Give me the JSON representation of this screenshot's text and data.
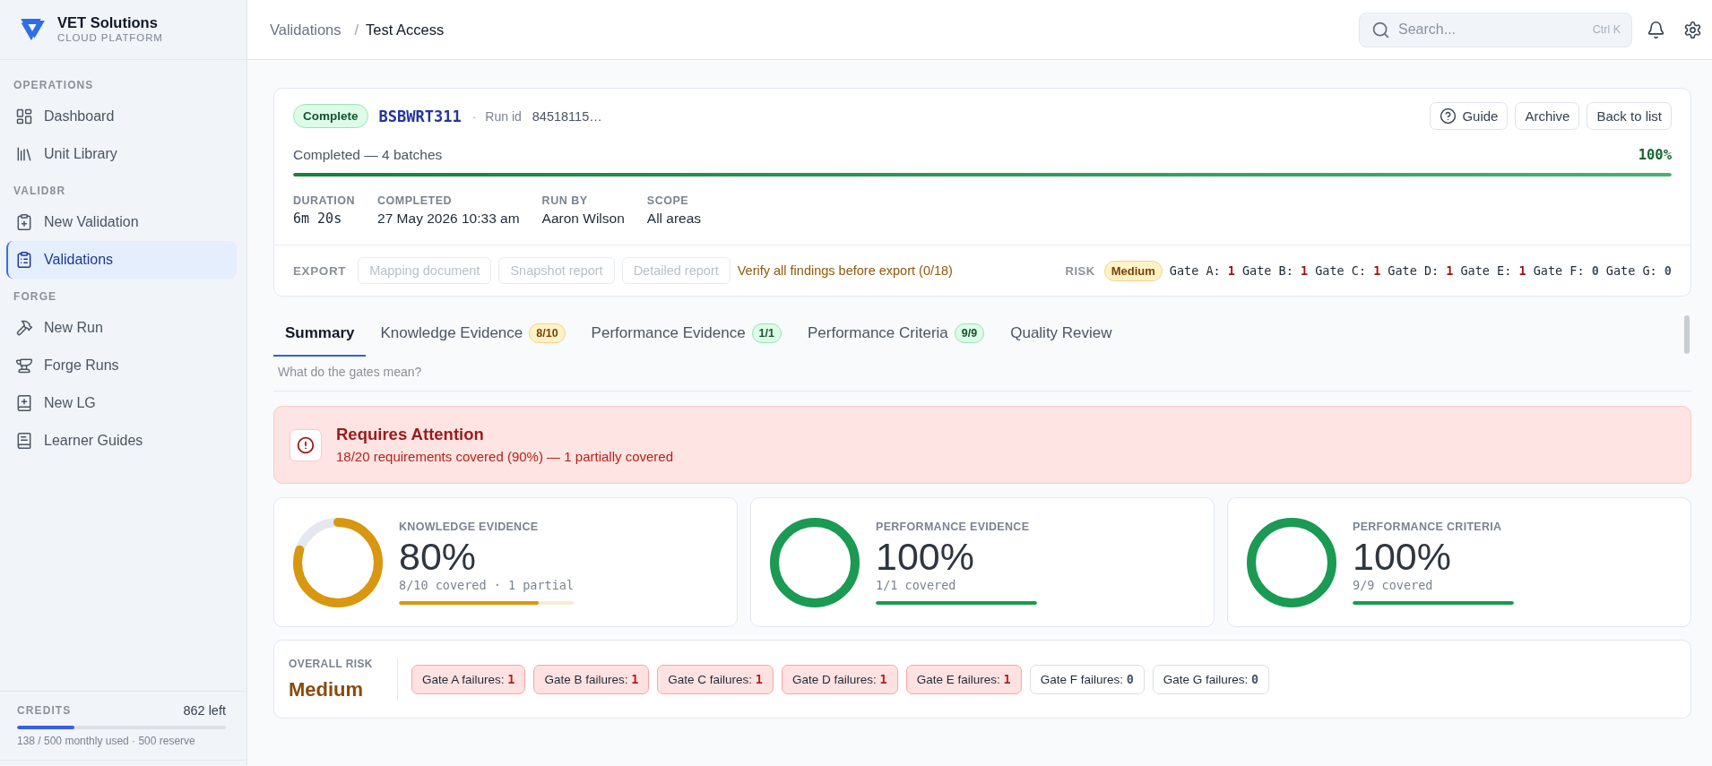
{
  "sidebar": {
    "brand": {
      "name": "VET Solutions",
      "tagline": "CLOUD PLATFORM"
    },
    "sections": [
      {
        "title": "OPERATIONS",
        "items": [
          {
            "label": "Dashboard",
            "selected": false
          },
          {
            "label": "Unit Library",
            "selected": false
          }
        ]
      },
      {
        "title": "VALID8R",
        "items": [
          {
            "label": "New Validation",
            "selected": false
          },
          {
            "label": "Validations",
            "selected": true
          }
        ]
      },
      {
        "title": "FORGE",
        "items": [
          {
            "label": "New Run",
            "selected": false
          },
          {
            "label": "Forge Runs",
            "selected": false
          },
          {
            "label": "New LG",
            "selected": false
          },
          {
            "label": "Learner Guides",
            "selected": false
          }
        ]
      }
    ],
    "credits": {
      "label": "CREDITS",
      "remaining": "862 left",
      "level": 0.276,
      "detail": "138 / 500 monthly used · 500 reserve"
    }
  },
  "topbar": {
    "breadcrumb": [
      {
        "label": "Validations",
        "current": false
      },
      {
        "label": "Test Access",
        "current": true
      }
    ],
    "separator": "/",
    "search": {
      "placeholder": "Search...",
      "shortcut": "Ctrl K"
    }
  },
  "run": {
    "status": {
      "label": "Complete",
      "kind": "success"
    },
    "code": "BSBWRT311",
    "separator": "·",
    "run_id_label": "Run id",
    "run_id": "84518115…",
    "actions": [
      {
        "label": "Guide",
        "with_icon": true
      },
      {
        "label": "Archive",
        "with_icon": false
      },
      {
        "label": "Back to list",
        "with_icon": false
      }
    ],
    "progress": {
      "label": "Completed — 4 batches",
      "percent": "100%",
      "level": 1
    },
    "meta": [
      {
        "label": "DURATION",
        "value": "6m 20s",
        "mono": true
      },
      {
        "label": "COMPLETED",
        "value": "27 May 2026 10:33 am",
        "mono": false
      },
      {
        "label": "RUN BY",
        "value": "Aaron Wilson",
        "mono": false
      },
      {
        "label": "SCOPE",
        "value": "All areas",
        "mono": false
      }
    ],
    "export": {
      "label": "EXPORT",
      "buttons": [
        {
          "label": "Mapping document",
          "disabled": true
        },
        {
          "label": "Snapshot report",
          "disabled": true
        },
        {
          "label": "Detailed report",
          "disabled": true
        }
      ],
      "note": "Verify all findings before export (0/18)"
    },
    "risk": {
      "label": "RISK",
      "badge": {
        "label": "Medium",
        "kind": "warning"
      },
      "gates": [
        {
          "label": "Gate A:",
          "count": "1",
          "failing": true
        },
        {
          "label": "Gate B:",
          "count": "1",
          "failing": true
        },
        {
          "label": "Gate C:",
          "count": "1",
          "failing": true
        },
        {
          "label": "Gate D:",
          "count": "1",
          "failing": true
        },
        {
          "label": "Gate E:",
          "count": "1",
          "failing": true
        },
        {
          "label": "Gate F:",
          "count": "0",
          "failing": false
        },
        {
          "label": "Gate G:",
          "count": "0",
          "failing": false
        }
      ]
    }
  },
  "tabs": [
    {
      "label": "Summary",
      "selected": true
    },
    {
      "label": "Knowledge Evidence",
      "selected": false,
      "badge": {
        "text": "8/10",
        "kind": "warning"
      }
    },
    {
      "label": "Performance Evidence",
      "selected": false,
      "badge": {
        "text": "1/1",
        "kind": "success"
      }
    },
    {
      "label": "Performance Criteria",
      "selected": false,
      "badge": {
        "text": "9/9",
        "kind": "success"
      }
    },
    {
      "label": "Quality Review",
      "selected": false
    }
  ],
  "help_link": "What do the gates mean?",
  "alert": {
    "kind": "danger",
    "title": "Requires Attention",
    "message": "18/20 requirements covered (90%) — 1 partially covered"
  },
  "coverage": [
    {
      "label": "KNOWLEDGE EVIDENCE",
      "value": "80%",
      "detail": "8/10 covered · 1 partial",
      "level": 0.8,
      "color": "#d9960f"
    },
    {
      "label": "PERFORMANCE EVIDENCE",
      "value": "100%",
      "detail": "1/1 covered",
      "level": 1,
      "color": "#1a9a52"
    },
    {
      "label": "PERFORMANCE CRITERIA",
      "value": "100%",
      "detail": "9/9 covered",
      "level": 1,
      "color": "#1a9a52"
    }
  ],
  "overall_risk": {
    "label": "OVERALL RISK",
    "value": {
      "text": "Medium",
      "kind": "warning"
    },
    "chips": [
      {
        "label": "Gate A failures:",
        "count": "1",
        "failing": true
      },
      {
        "label": "Gate B failures:",
        "count": "1",
        "failing": true
      },
      {
        "label": "Gate C failures:",
        "count": "1",
        "failing": true
      },
      {
        "label": "Gate D failures:",
        "count": "1",
        "failing": true
      },
      {
        "label": "Gate E failures:",
        "count": "1",
        "failing": true
      },
      {
        "label": "Gate F failures:",
        "count": "0",
        "failing": false
      },
      {
        "label": "Gate G failures:",
        "count": "0",
        "failing": false
      }
    ]
  }
}
